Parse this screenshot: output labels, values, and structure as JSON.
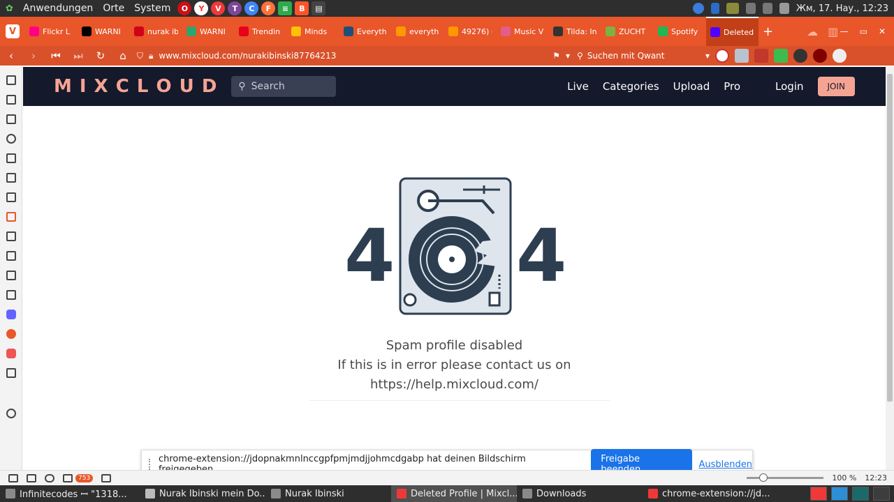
{
  "system_bar": {
    "menus": [
      "Anwendungen",
      "Orte",
      "System"
    ],
    "datetime": "Жм, 17. Нау., 12:23"
  },
  "tabs": [
    {
      "label": "Flickr L",
      "color": "#ff0084"
    },
    {
      "label": "WARNI",
      "color": "#000000"
    },
    {
      "label": "nurak ib",
      "color": "#d0021b"
    },
    {
      "label": "WARNI",
      "color": "#2fa56b"
    },
    {
      "label": "Trendin",
      "color": "#e8001c"
    },
    {
      "label": "Minds",
      "color": "#ffc107"
    },
    {
      "label": "Everyth",
      "color": "#1f4e79"
    },
    {
      "label": "everyth",
      "color": "#ff9800"
    },
    {
      "label": "49276) (",
      "color": "#ff9800"
    },
    {
      "label": "Music V",
      "color": "#e35d8a"
    },
    {
      "label": "Tilda: In",
      "color": "#333333"
    },
    {
      "label": "ZUCHT",
      "color": "#7cb342"
    },
    {
      "label": "Spotify",
      "color": "#1db954"
    },
    {
      "label": "Deleted",
      "color": "#5000ff",
      "active": true
    }
  ],
  "address_bar": {
    "url": "www.mixcloud.com/nurakibinski87764213",
    "search_placeholder": "Suchen mit Qwant"
  },
  "mixcloud": {
    "logo": "M I X C L O U D",
    "search_placeholder": "Search",
    "nav_links": [
      "Live",
      "Categories",
      "Upload",
      "Pro"
    ],
    "login": "Login",
    "join": "JOIN"
  },
  "error": {
    "left_digit": "4",
    "right_digit": "4",
    "line1": "Spam profile disabled",
    "line2": "If this is in error please contact us on",
    "line3": "https://help.mixcloud.com/"
  },
  "share_notice": {
    "text": "chrome-extension://jdopnakmnlnccgpfpmjmdjjohmcdgabp hat deinen Bildschirm freigegeben.",
    "stop_button": "Freigabe beenden",
    "hide_link": "Ausblenden"
  },
  "status_bar": {
    "badge": "753",
    "zoom": "100 %",
    "time": "12:23"
  },
  "taskbar": {
    "tasks": [
      {
        "label": "Infinitecodes ꟷ \"1318...",
        "active": false
      },
      {
        "label": "Nurak Ibinski mein Do...",
        "active": false
      },
      {
        "label": "Nurak Ibinski",
        "active": false
      },
      {
        "label": "Deleted Profile | Mixcl...",
        "active": true
      },
      {
        "label": "Downloads",
        "active": false
      },
      {
        "label": "chrome-extension://jd...",
        "active": false
      }
    ]
  },
  "colors": {
    "vivaldi_accent": "#e8562a",
    "mixcloud_nav": "#14192b",
    "mixcloud_pink": "#f5a494",
    "error_dark": "#2d3e50",
    "share_blue": "#1a73e8"
  }
}
